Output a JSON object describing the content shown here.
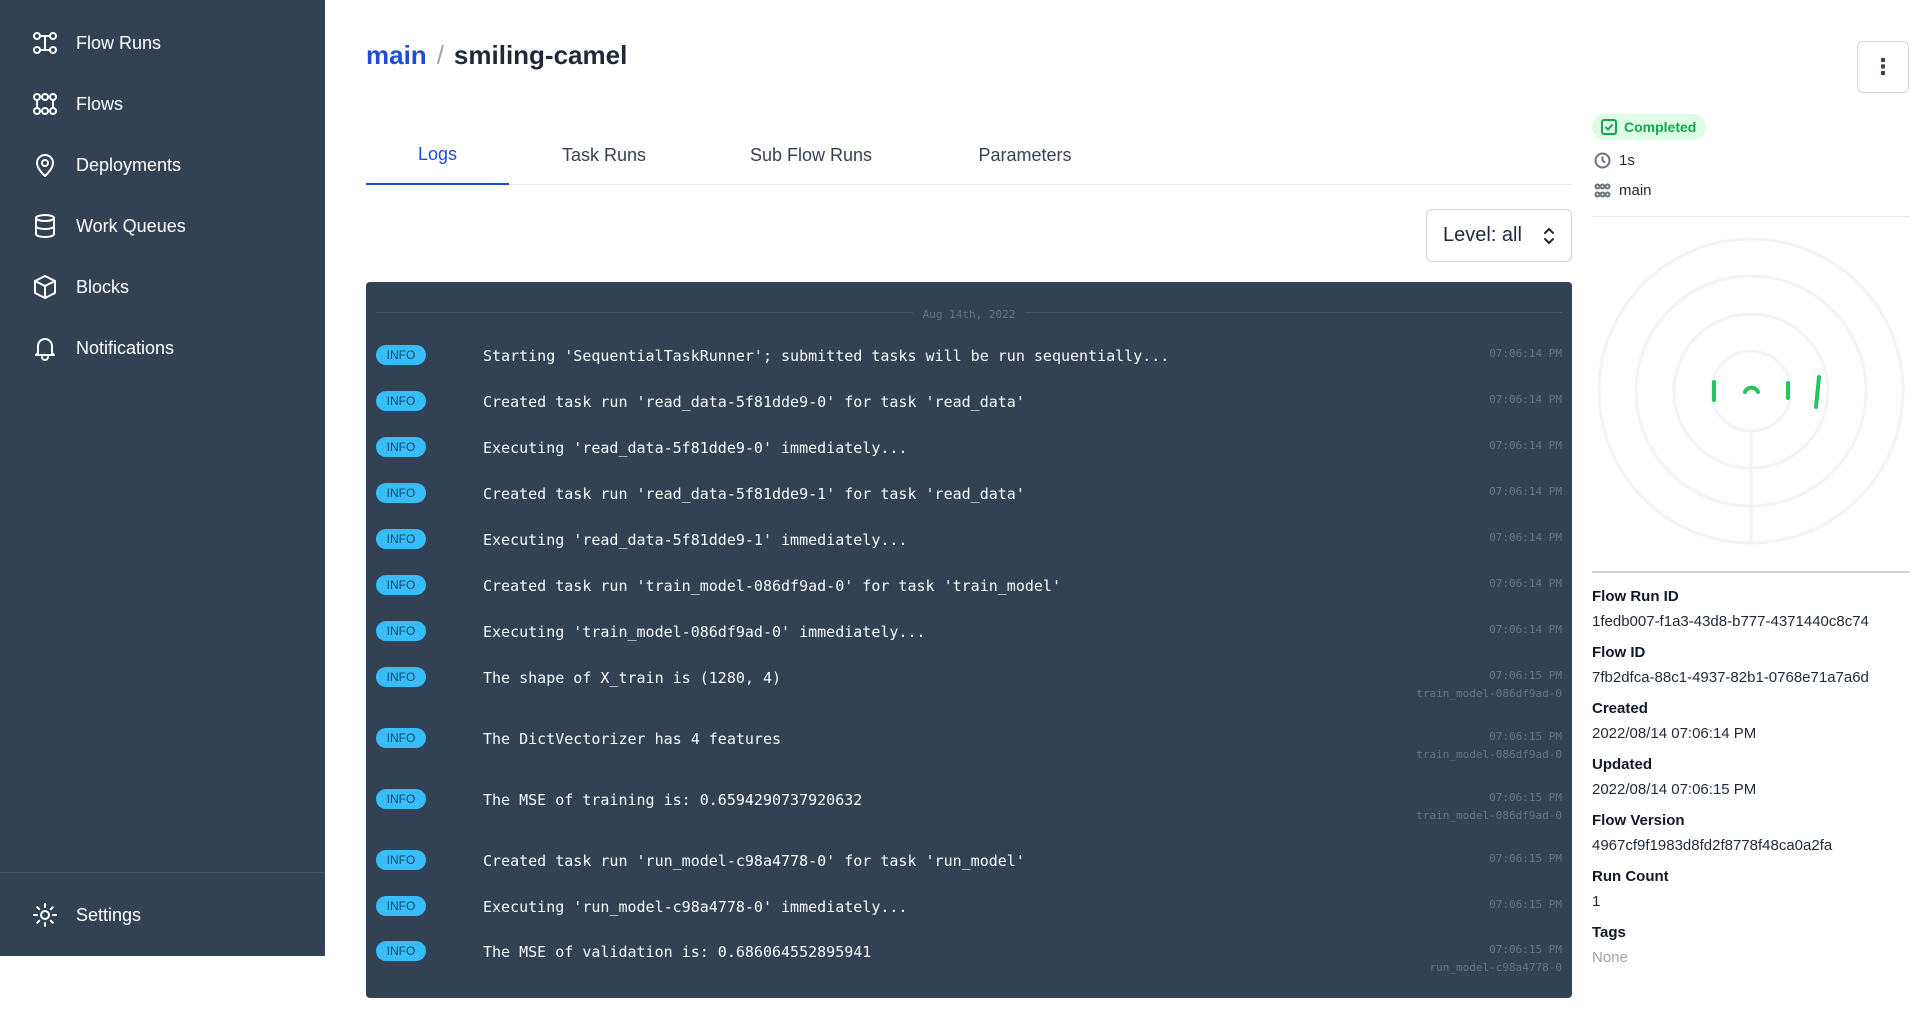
{
  "sidebar": {
    "items": [
      {
        "label": "Flow Runs",
        "icon": "flow-runs-icon"
      },
      {
        "label": "Flows",
        "icon": "flows-icon"
      },
      {
        "label": "Deployments",
        "icon": "location-pin-icon"
      },
      {
        "label": "Work Queues",
        "icon": "database-icon"
      },
      {
        "label": "Blocks",
        "icon": "cube-icon"
      },
      {
        "label": "Notifications",
        "icon": "bell-icon"
      }
    ],
    "settings_label": "Settings"
  },
  "header": {
    "breadcrumb_flow": "main",
    "separator": "/",
    "run_name": "smiling-camel"
  },
  "tabs": [
    "Logs",
    "Task Runs",
    "Sub Flow Runs",
    "Parameters"
  ],
  "active_tab": "Logs",
  "filter": {
    "level_label": "Level: all"
  },
  "logs": {
    "date": "Aug 14th, 2022",
    "entries": [
      {
        "level": "INFO",
        "message": "Starting 'SequentialTaskRunner'; submitted tasks will be run sequentially...",
        "time": "07:06:14 PM",
        "task": ""
      },
      {
        "level": "INFO",
        "message": "Created task run 'read_data-5f81dde9-0' for task 'read_data'",
        "time": "07:06:14 PM",
        "task": ""
      },
      {
        "level": "INFO",
        "message": "Executing 'read_data-5f81dde9-0' immediately...",
        "time": "07:06:14 PM",
        "task": ""
      },
      {
        "level": "INFO",
        "message": "Created task run 'read_data-5f81dde9-1' for task 'read_data'",
        "time": "07:06:14 PM",
        "task": ""
      },
      {
        "level": "INFO",
        "message": "Executing 'read_data-5f81dde9-1' immediately...",
        "time": "07:06:14 PM",
        "task": ""
      },
      {
        "level": "INFO",
        "message": "Created task run 'train_model-086df9ad-0' for task 'train_model'",
        "time": "07:06:14 PM",
        "task": ""
      },
      {
        "level": "INFO",
        "message": "Executing 'train_model-086df9ad-0' immediately...",
        "time": "07:06:14 PM",
        "task": ""
      },
      {
        "level": "INFO",
        "message": "The shape of X_train is (1280, 4)",
        "time": "07:06:15 PM",
        "task": "train_model-086df9ad-0"
      },
      {
        "level": "INFO",
        "message": "The DictVectorizer has 4 features",
        "time": "07:06:15 PM",
        "task": "train_model-086df9ad-0"
      },
      {
        "level": "INFO",
        "message": "The MSE of training is: 0.6594290737920632",
        "time": "07:06:15 PM",
        "task": "train_model-086df9ad-0"
      },
      {
        "level": "INFO",
        "message": "Created task run 'run_model-c98a4778-0' for task 'run_model'",
        "time": "07:06:15 PM",
        "task": ""
      },
      {
        "level": "INFO",
        "message": "Executing 'run_model-c98a4778-0' immediately...",
        "time": "07:06:15 PM",
        "task": ""
      },
      {
        "level": "INFO",
        "message": "The MSE of validation is: 0.686064552895941",
        "time": "07:06:15 PM",
        "task": "run_model-c98a4778-0"
      }
    ]
  },
  "details": {
    "state": "Completed",
    "state_color": "#16a34a",
    "duration": "1s",
    "flow_name": "main",
    "fields": [
      {
        "label": "Flow Run ID",
        "value": "1fedb007-f1a3-43d8-b777-4371440c8c74"
      },
      {
        "label": "Flow ID",
        "value": "7fb2dfca-88c1-4937-82b1-0768e71a7a6d"
      },
      {
        "label": "Created",
        "value": "2022/08/14 07:06:14 PM"
      },
      {
        "label": "Updated",
        "value": "2022/08/14 07:06:15 PM"
      },
      {
        "label": "Flow Version",
        "value": "4967cf9f1983d8fd2f8778f48ca0a2fa"
      },
      {
        "label": "Run Count",
        "value": "1"
      },
      {
        "label": "Tags",
        "value": "None"
      }
    ]
  }
}
